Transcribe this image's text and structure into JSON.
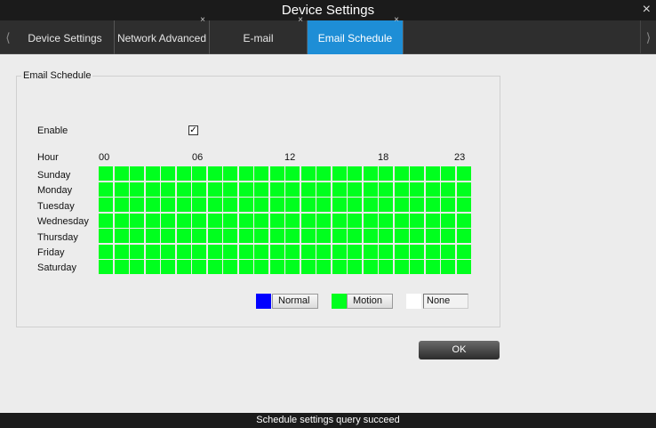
{
  "window": {
    "title": "Device Settings"
  },
  "tabs": [
    {
      "label": "Device Settings",
      "closable": false,
      "active": false
    },
    {
      "label": "Network Advanced",
      "closable": true,
      "active": false
    },
    {
      "label": "E-mail",
      "closable": true,
      "active": false
    },
    {
      "label": "Email Schedule",
      "closable": true,
      "active": true
    }
  ],
  "close_glyph": "×",
  "group": {
    "title": "Email Schedule"
  },
  "enable": {
    "label": "Enable",
    "checked": true,
    "check_glyph": "✓"
  },
  "hour": {
    "label": "Hour",
    "ticks": [
      "00",
      "06",
      "12",
      "18",
      "23"
    ]
  },
  "days": [
    "Sunday",
    "Monday",
    "Tuesday",
    "Wednesday",
    "Thursday",
    "Friday",
    "Saturday"
  ],
  "schedule": {
    "hours_per_day": 24,
    "fill_mode": "motion"
  },
  "legend": [
    {
      "label": "Normal",
      "color": "#0000ff"
    },
    {
      "label": "Motion",
      "color": "#00ff1e"
    },
    {
      "label": "None",
      "color": "#ffffff"
    }
  ],
  "ok_label": "OK",
  "status": "Schedule settings query succeed",
  "colors": {
    "accent": "#1e8ed6",
    "motion": "#00ff1e",
    "normal": "#0000ff",
    "none": "#ffffff"
  }
}
